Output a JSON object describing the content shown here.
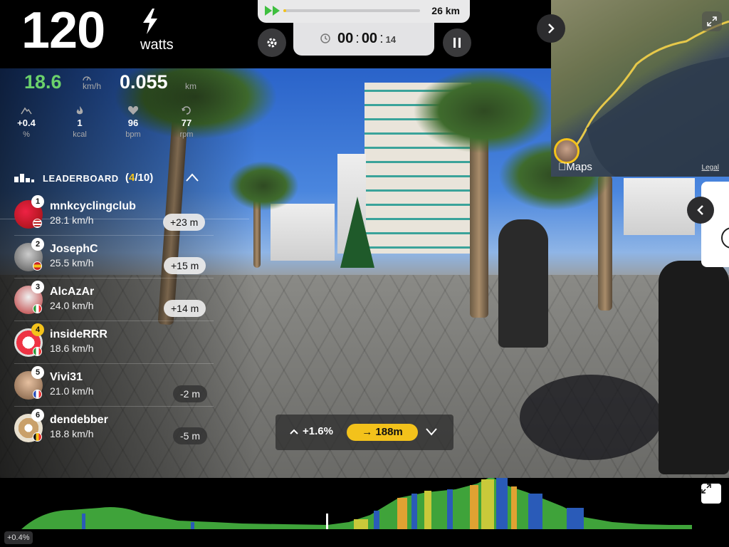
{
  "power": {
    "value": "120",
    "unit": "watts"
  },
  "route": {
    "total_distance": "26 km",
    "progress_fraction": 0.01
  },
  "timer": {
    "hours": "00",
    "minutes": "00",
    "seconds": "14"
  },
  "stats": {
    "speed": {
      "value": "18.6",
      "unit": "km/h"
    },
    "distance": {
      "value": "0.055",
      "unit": "km"
    },
    "grade": {
      "value": "+0.4",
      "unit": "%"
    },
    "calories": {
      "value": "1",
      "unit": "kcal"
    },
    "heart_rate": {
      "value": "96",
      "unit": "bpm"
    },
    "cadence": {
      "value": "77",
      "unit": "rpm"
    }
  },
  "leaderboard": {
    "title": "LEADERBOARD",
    "position": "4",
    "total": "/10",
    "riders": [
      {
        "rank": "1",
        "name": "mnkcyclingclub",
        "speed": "28.1 km/h",
        "gap": "+23 m"
      },
      {
        "rank": "2",
        "name": "JosephC",
        "speed": "25.5 km/h",
        "gap": "+15 m"
      },
      {
        "rank": "3",
        "name": "AlcAzAr",
        "speed": "24.0 km/h",
        "gap": "+14 m"
      },
      {
        "rank": "4",
        "name": "insideRRR",
        "speed": "18.6 km/h",
        "gap": ""
      },
      {
        "rank": "5",
        "name": "Vivi31",
        "speed": "21.0 km/h",
        "gap": "-2 m"
      },
      {
        "rank": "6",
        "name": "dendebber",
        "speed": "18.8 km/h",
        "gap": "-5 m"
      }
    ]
  },
  "grade_bar": {
    "grade": "+1.6%",
    "next_distance": "188m"
  },
  "map": {
    "brand": "Maps",
    "legal": "Legal"
  },
  "profile": {
    "current_grade": "+0.4%"
  },
  "colors": {
    "accent": "#f3c21b",
    "speed_green": "#6bd16b",
    "grade_green": "#3fa33a",
    "grade_blue": "#2a5bb8"
  }
}
